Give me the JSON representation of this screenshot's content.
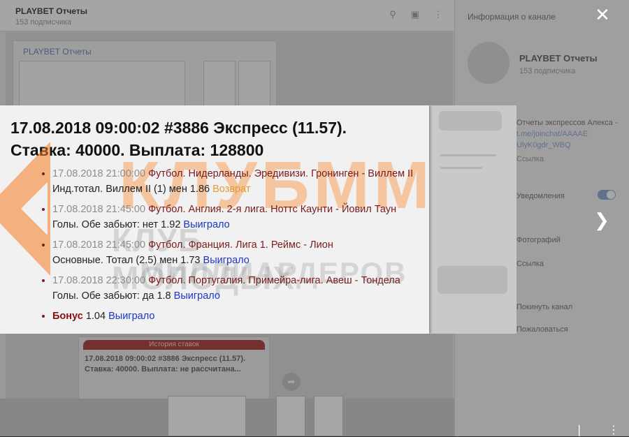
{
  "chat": {
    "title": "PLAYBET Отчеты",
    "subtitle": "153 подписчика",
    "post_title": "PLAYBET Отчеты",
    "lower_header": "История ставок",
    "lower_text_1": "17.08.2018 09:00:02 #3886 Экспресс (11.57).",
    "lower_text_2": "Ставка: 40000. Выплата: не рассчитана..."
  },
  "sidebar": {
    "title": "Информация о канале",
    "channel_name": "PLAYBET Отчеты",
    "channel_sub": "153 подписчика",
    "description": "Отчеты экспрессов Алекса -",
    "link": "t.me/joinchat/AAAAE",
    "link2": "UlyK0gdr_WBQ",
    "link_label": "Ссылка",
    "notifications": "Уведомления",
    "photos": "Фотографий",
    "links": "Ссылка",
    "leave": "Покинуть канал",
    "report": "Пожаловаться"
  },
  "viewer": {
    "close_icon": "close-icon",
    "next_icon": "chevron-right-icon"
  },
  "bet": {
    "title_line1": "17.08.2018 09:00:02 #3886 Экспресс (11.57).",
    "title_line2": "Ставка: 40000. Выплата: 128800",
    "items": [
      {
        "datetime": "17.08.2018 21:00:00",
        "event": "Футбол. Нидерланды. Эредивизи. Гронинген - Виллем II",
        "detail": "Инд.тотал. Виллем II (1) мен 1.86",
        "result": "Возврат",
        "result_type": "return"
      },
      {
        "datetime": "17.08.2018 21:45:00",
        "event": "Футбол. Англия. 2-я лига. Ноттс Каунти - Йовил Таун",
        "detail": "Голы. Обе забьют: нет 1.92",
        "result": "Выиграло",
        "result_type": "win"
      },
      {
        "datetime": "17.08.2018 21:45:00",
        "event": "Футбол. Франция. Лига 1. Реймс - Лион",
        "detail": "Основные. Тотал (2.5) мен 1.73",
        "result": "Выиграло",
        "result_type": "win"
      },
      {
        "datetime": "17.08.2018 22:30:00",
        "event": "Футбол. Португалия. Примейра-лига. Авеш - Тондела",
        "detail": "Голы. Обе забьют: да 1.8",
        "result": "Выиграло",
        "result_type": "win"
      }
    ],
    "bonus_label": "Бонус",
    "bonus_value": "1.04",
    "bonus_result": "Выиграло"
  },
  "watermark": {
    "big": "КЛУБММ",
    "line1": "КЛУБ МОЛОДЫХ",
    "line2": "МИЛЛИАРДЕРОВ"
  },
  "colors": {
    "event": "#7a1c1c",
    "win": "#1a36c8",
    "return": "#e49a2e",
    "watermark": "#f67c20"
  }
}
